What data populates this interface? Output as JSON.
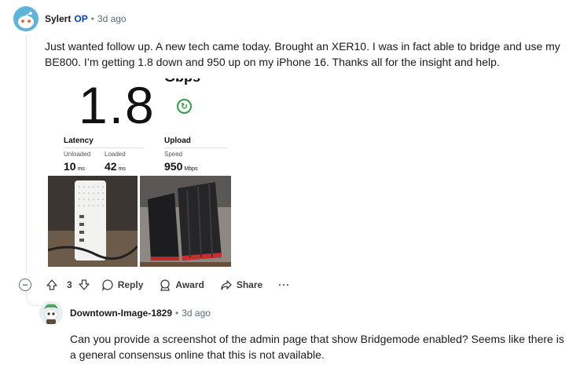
{
  "comment1": {
    "author": "Sylert",
    "op_badge": "OP",
    "separator": "•",
    "time": "3d ago",
    "body": "Just wanted follow up. A new tech came today. Brought an XER10. I was in fact able to bridge and use my BE800. I’m getting 1.8 down and 950 up on my iPhone 16. Thanks all for the insight and help.",
    "embed": {
      "speed_value": "1.8",
      "speed_unit": "Gbps",
      "latency_heading": "Latency",
      "unloaded_label": "Unloaded",
      "unloaded_value": "10",
      "unloaded_unit": "ms",
      "loaded_label": "Loaded",
      "loaded_value": "42",
      "loaded_unit": "ms",
      "upload_heading": "Upload",
      "upload_speed_label": "Speed",
      "upload_value": "950",
      "upload_unit": "Mbps"
    },
    "actions": {
      "collapse_symbol": "−",
      "vote_count": "3",
      "reply_label": "Reply",
      "award_label": "Award",
      "share_label": "Share",
      "more_label": "···"
    }
  },
  "comment2": {
    "author": "Downtown-Image-1829",
    "separator": "•",
    "time": "3d ago",
    "body": "Can you provide a screenshot of the admin page that show Bridgemode enabled? Seems like there is a general consensus online that this is not available."
  },
  "icons": {
    "upvote": "arrow-up-icon",
    "downvote": "arrow-down-icon",
    "reply": "speech-bubble-icon",
    "award": "award-icon",
    "share": "share-arrow-icon",
    "refresh": "refresh-icon"
  },
  "colors": {
    "op_badge": "#0045ac",
    "meta_gray": "#576f76",
    "avatar1_bg": "#5fb4d9",
    "refresh_green": "#2e9e3e"
  }
}
